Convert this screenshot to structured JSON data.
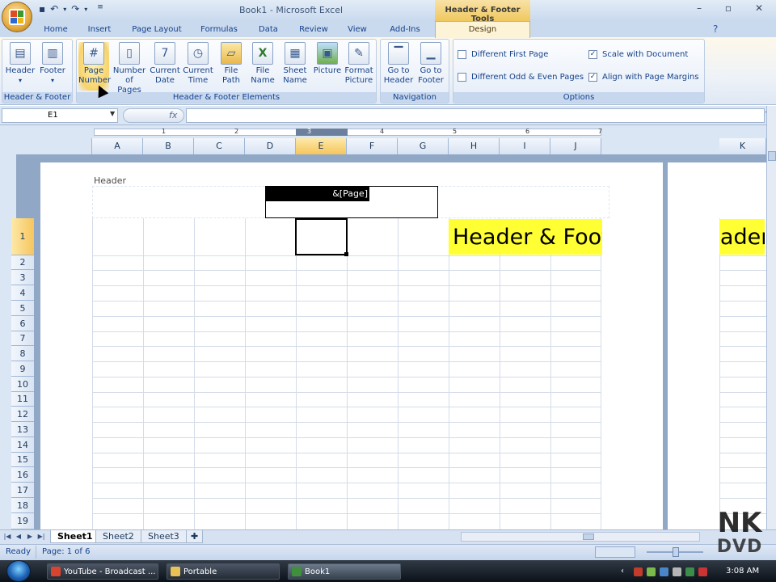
{
  "window": {
    "title": "Book1 - Microsoft Excel",
    "contextual_title": "Header & Footer Tools"
  },
  "tabs": [
    "Home",
    "Insert",
    "Page Layout",
    "Formulas",
    "Data",
    "Review",
    "View",
    "Add-Ins"
  ],
  "active_tab": "Design",
  "ribbon": {
    "group_header_footer": {
      "label": "Header & Footer",
      "buttons": [
        "Header",
        "Footer"
      ]
    },
    "group_elements": {
      "label": "Header & Footer Elements",
      "buttons": [
        {
          "line1": "Page",
          "line2": "Number",
          "icon": "#"
        },
        {
          "line1": "Number",
          "line2": "of Pages",
          "icon": "▯"
        },
        {
          "line1": "Current",
          "line2": "Date",
          "icon": "7"
        },
        {
          "line1": "Current",
          "line2": "Time",
          "icon": "◷"
        },
        {
          "line1": "File",
          "line2": "Path",
          "icon": "▱"
        },
        {
          "line1": "File",
          "line2": "Name",
          "icon": "X"
        },
        {
          "line1": "Sheet",
          "line2": "Name",
          "icon": "▦"
        },
        {
          "line1": "Picture",
          "line2": "",
          "icon": "▣"
        },
        {
          "line1": "Format",
          "line2": "Picture",
          "icon": "✎"
        }
      ]
    },
    "group_navigation": {
      "label": "Navigation",
      "buttons": [
        {
          "line1": "Go to",
          "line2": "Header"
        },
        {
          "line1": "Go to",
          "line2": "Footer"
        }
      ]
    },
    "group_options": {
      "label": "Options",
      "items": [
        {
          "label": "Different First Page",
          "checked": false
        },
        {
          "label": "Different Odd & Even Pages",
          "checked": false
        },
        {
          "label": "Scale with Document",
          "checked": true
        },
        {
          "label": "Align with Page Margins",
          "checked": true
        }
      ]
    }
  },
  "formula_bar": {
    "name_box": "E1",
    "fx": "fx",
    "value": ""
  },
  "sheet": {
    "columns": [
      "A",
      "B",
      "C",
      "D",
      "E",
      "F",
      "G",
      "H",
      "I",
      "J",
      "K"
    ],
    "rows": [
      "1",
      "2",
      "3",
      "4",
      "5",
      "6",
      "7",
      "8",
      "9",
      "10",
      "11",
      "12",
      "13",
      "14",
      "15",
      "16",
      "17",
      "18",
      "19"
    ],
    "ruler_marks": [
      "1",
      "2",
      "3",
      "4",
      "5",
      "6",
      "7"
    ],
    "header_label": "Header",
    "header_center_code": "&[Page]",
    "banner_text": "Header & Footer",
    "banner_text_page2": "Header & Footer",
    "active_cell": "E1",
    "accent_color": "#ffff33"
  },
  "sheet_tabs": [
    "Sheet1",
    "Sheet2",
    "Sheet3"
  ],
  "status": {
    "ready": "Ready",
    "page": "Page: 1 of 6"
  },
  "taskbar": {
    "items": [
      "YouTube - Broadcast ...",
      "Portable",
      "Book1"
    ],
    "clock": "3:08 AM"
  },
  "watermark": {
    "line1": "NK",
    "line2": "DVD"
  }
}
